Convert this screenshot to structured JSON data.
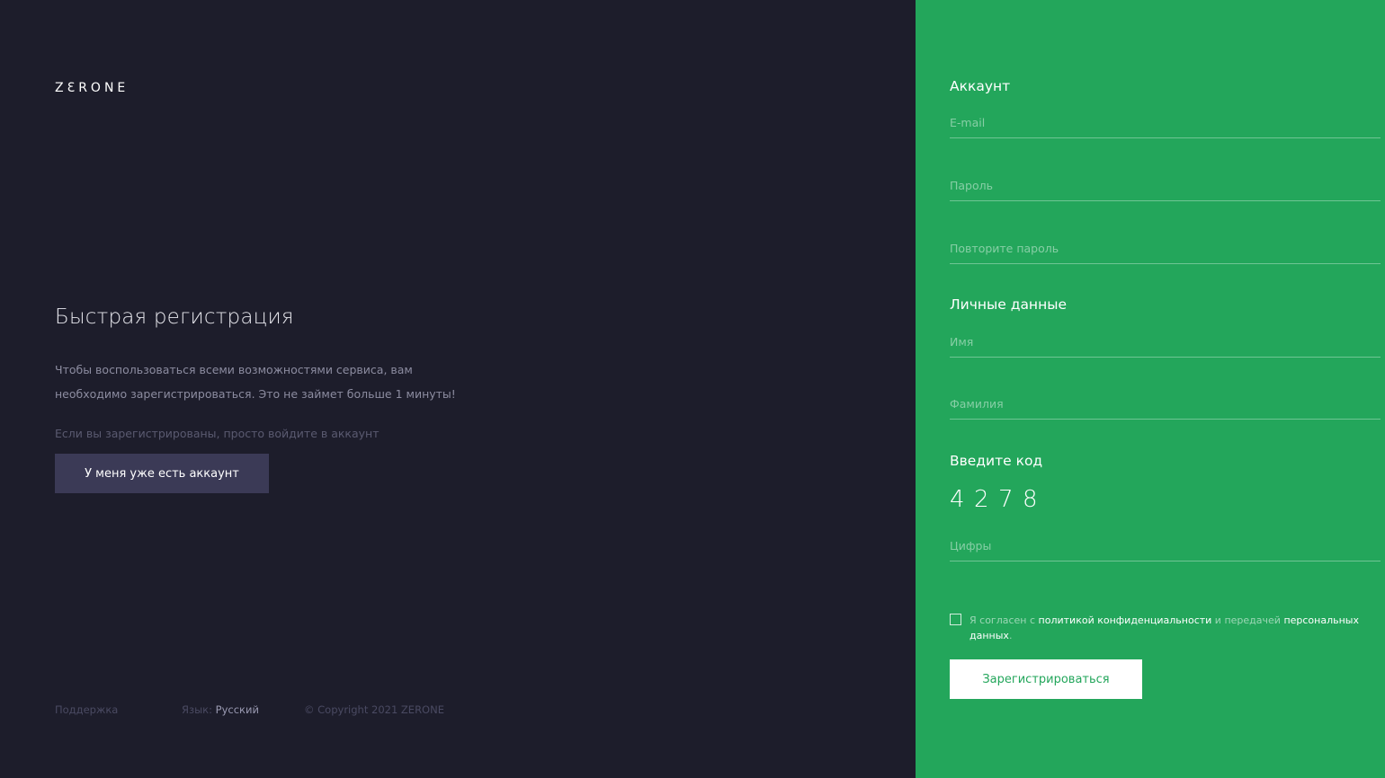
{
  "brand": {
    "logo": "ZƐRONE"
  },
  "intro": {
    "title": "Быстрая регистрация",
    "text": "Чтобы воспользоваться всеми возможностями сервиса, вам необходимо зарегистрироваться. Это не займет больше 1 минуты!",
    "note": "Если вы зарегистрированы, просто войдите в аккаунт",
    "login_button": "У меня уже есть аккаунт"
  },
  "footer": {
    "support": "Поддержка",
    "language_label": "Язык:",
    "language_value": "Русский",
    "copyright": "© Copyright 2021 ZERONE"
  },
  "form": {
    "account_title": "Аккаунт",
    "email_placeholder": "E-mail",
    "password_placeholder": "Пароль",
    "repeat_password_placeholder": "Повторите пароль",
    "personal_title": "Личные данные",
    "first_name_placeholder": "Имя",
    "last_name_placeholder": "Фамилия",
    "code_title": "Введите код",
    "code_digits": [
      "4",
      "2",
      "7",
      "8"
    ],
    "code_placeholder": "Цифры",
    "agree": {
      "part1": "Я согласен с ",
      "link1": "политикой конфиденциальности",
      "part2": " и передачей ",
      "link2": "персональных данных",
      "part3": "."
    },
    "submit_button": "Зарегистрироваться"
  },
  "colors": {
    "dark_bg": "#1d1d2b",
    "green_bg": "#23a65b",
    "login_button_bg": "#3b3a56"
  }
}
